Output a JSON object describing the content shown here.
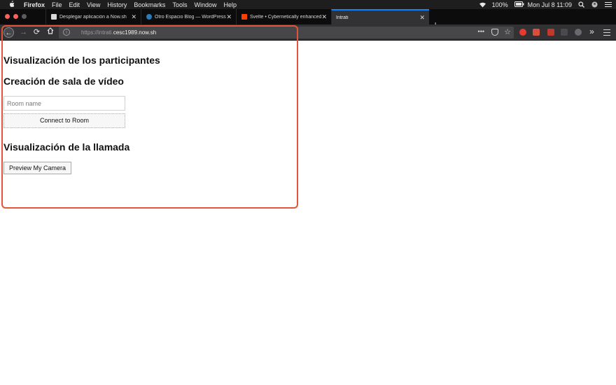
{
  "menubar": {
    "app_name": "Firefox",
    "items": [
      "File",
      "Edit",
      "View",
      "History",
      "Bookmarks",
      "Tools",
      "Window",
      "Help"
    ],
    "battery": "100%",
    "clock": "Mon Jul 8  11:09"
  },
  "tabs": [
    {
      "title": "Desplegar aplicación a Now.sh",
      "favicon_color": "#d8d8d8",
      "active": false
    },
    {
      "title": "Otro Espacio Blog — WordPress",
      "favicon_color": "#2b7bb9",
      "active": false
    },
    {
      "title": "Svelte • Cybernetically enhanced",
      "favicon_color": "#ff3e00",
      "active": false
    },
    {
      "title": "Intrati",
      "favicon_color": "",
      "active": true
    }
  ],
  "navbar": {
    "url_scheme": "https://",
    "url_host_prefix": "intrati.",
    "url_host": "cesc1989.now.sh",
    "more_label": "•••"
  },
  "page": {
    "heading_participants": "Visualización de los participantes",
    "heading_room": "Creación de sala de vídeo",
    "room_placeholder": "Room name",
    "connect_label": "Connect to Room",
    "heading_call": "Visualización de la llamada",
    "preview_label": "Preview My Camera"
  },
  "colors": {
    "highlight": "#e2553a",
    "active_tab_accent": "#0a84ff",
    "toolbar_bg": "#323234"
  }
}
